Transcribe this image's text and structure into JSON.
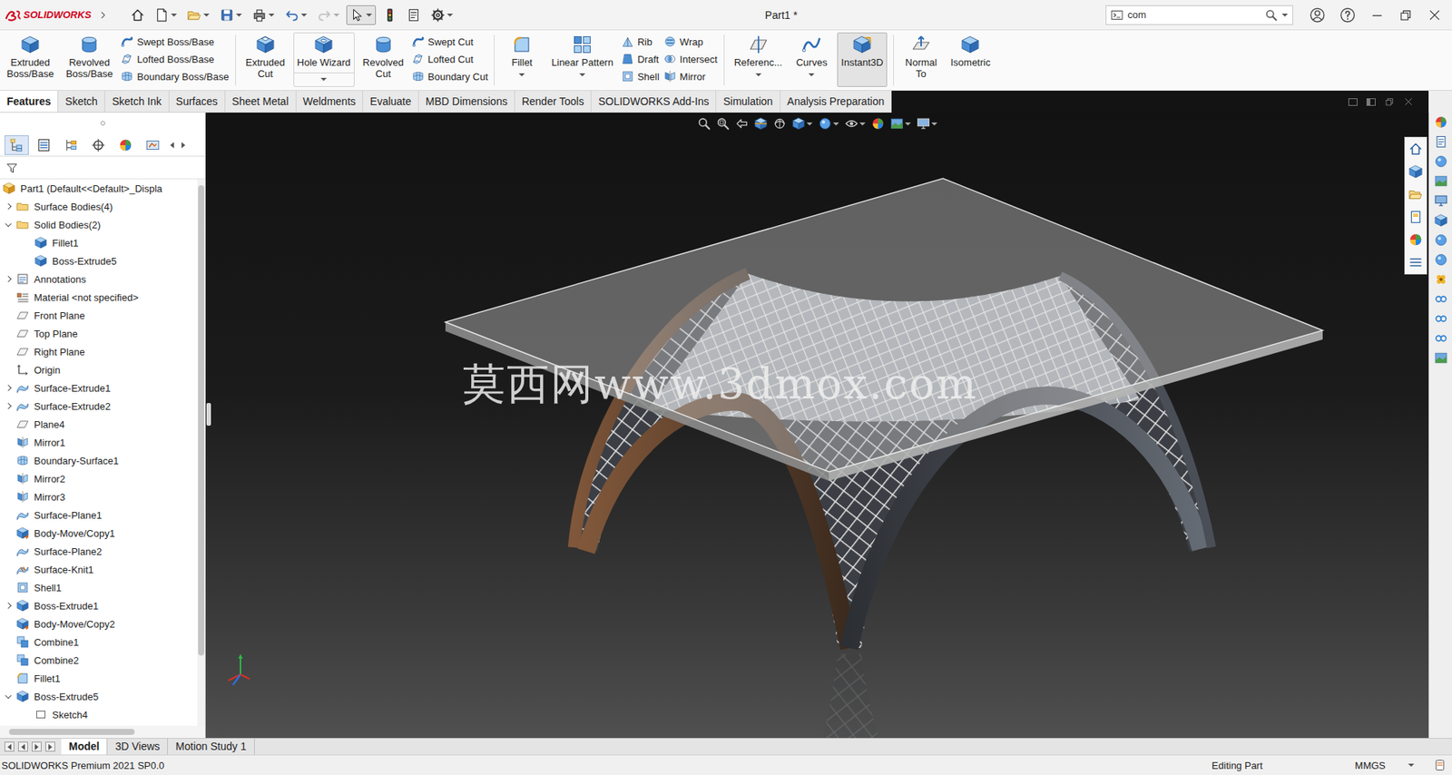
{
  "window": {
    "app": "SOLIDWORKS",
    "title": "Part1 *"
  },
  "quick_access": [
    {
      "dropdown": false,
      "selected": false,
      "disabled": false
    },
    {
      "dropdown": true,
      "selected": false,
      "disabled": false
    },
    {
      "dropdown": true,
      "selected": false,
      "disabled": false
    },
    {
      "dropdown": true,
      "selected": false,
      "disabled": false
    },
    {
      "dropdown": true,
      "selected": false,
      "disabled": false
    },
    {
      "dropdown": true,
      "selected": false,
      "disabled": false
    },
    {
      "dropdown": true,
      "selected": false,
      "disabled": true
    },
    {
      "dropdown": true,
      "selected": true,
      "disabled": false
    },
    {
      "dropdown": false,
      "selected": false,
      "disabled": false
    },
    {
      "dropdown": false,
      "selected": false,
      "disabled": false
    },
    {
      "dropdown": true,
      "selected": false,
      "disabled": false
    }
  ],
  "search": {
    "value": "com"
  },
  "ribbon": {
    "groups": [
      [
        {
          "kind": "large",
          "lines": [
            "Extruded",
            "Boss/Base"
          ],
          "selected": false,
          "dropdown": false
        },
        {
          "kind": "large",
          "lines": [
            "Revolved",
            "Boss/Base"
          ],
          "selected": false,
          "dropdown": false
        },
        {
          "kind": "stack",
          "items": [
            {
              "label": "Swept Boss/Base"
            },
            {
              "label": "Lofted Boss/Base"
            },
            {
              "label": "Boundary Boss/Base"
            }
          ]
        }
      ],
      [
        {
          "kind": "large",
          "lines": [
            "Extruded",
            "Cut"
          ],
          "selected": false,
          "dropdown": false
        },
        {
          "kind": "split",
          "lines": [
            "Hole Wizard"
          ],
          "selected": false,
          "dropdown": true
        },
        {
          "kind": "large",
          "lines": [
            "Revolved",
            "Cut"
          ],
          "selected": false,
          "dropdown": false
        },
        {
          "kind": "stack",
          "items": [
            {
              "label": "Swept Cut"
            },
            {
              "label": "Lofted Cut"
            },
            {
              "label": "Boundary Cut"
            }
          ]
        }
      ],
      [
        {
          "kind": "large",
          "lines": [
            "Fillet"
          ],
          "selected": false,
          "dropdown": true
        },
        {
          "kind": "large",
          "lines": [
            "Linear Pattern"
          ],
          "selected": false,
          "dropdown": true
        },
        {
          "kind": "stack",
          "items": [
            {
              "label": "Rib"
            },
            {
              "label": "Draft"
            },
            {
              "label": "Shell"
            }
          ]
        },
        {
          "kind": "stack",
          "items": [
            {
              "label": "Wrap"
            },
            {
              "label": "Intersect"
            },
            {
              "label": "Mirror"
            }
          ]
        }
      ],
      [
        {
          "kind": "large",
          "lines": [
            "Referenc..."
          ],
          "selected": false,
          "dropdown": true
        },
        {
          "kind": "large",
          "lines": [
            "Curves"
          ],
          "selected": false,
          "dropdown": true
        },
        {
          "kind": "large",
          "lines": [
            "Instant3D"
          ],
          "selected": true,
          "dropdown": false
        }
      ],
      [
        {
          "kind": "large",
          "lines": [
            "Normal",
            "To"
          ],
          "selected": false,
          "dropdown": false
        },
        {
          "kind": "large",
          "lines": [
            "Isometric"
          ],
          "selected": false,
          "dropdown": false
        }
      ]
    ]
  },
  "tabs": [
    {
      "label": "Features",
      "selected": true
    },
    {
      "label": "Sketch",
      "selected": false
    },
    {
      "label": "Sketch Ink",
      "selected": false
    },
    {
      "label": "Surfaces",
      "selected": false
    },
    {
      "label": "Sheet Metal",
      "selected": false
    },
    {
      "label": "Weldments",
      "selected": false
    },
    {
      "label": "Evaluate",
      "selected": false
    },
    {
      "label": "MBD Dimensions",
      "selected": false
    },
    {
      "label": "Render Tools",
      "selected": false
    },
    {
      "label": "SOLIDWORKS Add-Ins",
      "selected": false
    },
    {
      "label": "Simulation",
      "selected": false
    },
    {
      "label": "Analysis Preparation",
      "selected": false
    }
  ],
  "panel": {
    "tabs": [
      {
        "selected": true
      },
      {
        "selected": false
      },
      {
        "selected": false
      },
      {
        "selected": false
      },
      {
        "selected": false
      },
      {
        "selected": false
      }
    ]
  },
  "tree": [
    {
      "label": "Part1 (Default<<Default>_Displa",
      "depth": 0,
      "expandable": false,
      "expanded": false
    },
    {
      "label": "Surface Bodies(4)",
      "depth": 1,
      "expandable": true,
      "expanded": false
    },
    {
      "label": "Solid Bodies(2)",
      "depth": 1,
      "expandable": true,
      "expanded": true
    },
    {
      "label": "Fillet1",
      "depth": 2,
      "expandable": false,
      "expanded": false
    },
    {
      "label": "Boss-Extrude5",
      "depth": 2,
      "expandable": false,
      "expanded": false
    },
    {
      "label": "Annotations",
      "depth": 1,
      "expandable": true,
      "expanded": false
    },
    {
      "label": "Material <not specified>",
      "depth": 1,
      "expandable": false,
      "expanded": false
    },
    {
      "label": "Front Plane",
      "depth": 1,
      "expandable": false,
      "expanded": false
    },
    {
      "label": "Top Plane",
      "depth": 1,
      "expandable": false,
      "expanded": false
    },
    {
      "label": "Right Plane",
      "depth": 1,
      "expandable": false,
      "expanded": false
    },
    {
      "label": "Origin",
      "depth": 1,
      "expandable": false,
      "expanded": false
    },
    {
      "label": "Surface-Extrude1",
      "depth": 1,
      "expandable": true,
      "expanded": false
    },
    {
      "label": "Surface-Extrude2",
      "depth": 1,
      "expandable": true,
      "expanded": false
    },
    {
      "label": "Plane4",
      "depth": 1,
      "expandable": false,
      "expanded": false
    },
    {
      "label": "Mirror1",
      "depth": 1,
      "expandable": false,
      "expanded": false
    },
    {
      "label": "Boundary-Surface1",
      "depth": 1,
      "expandable": false,
      "expanded": false
    },
    {
      "label": "Mirror2",
      "depth": 1,
      "expandable": false,
      "expanded": false
    },
    {
      "label": "Mirror3",
      "depth": 1,
      "expandable": false,
      "expanded": false
    },
    {
      "label": "Surface-Plane1",
      "depth": 1,
      "expandable": false,
      "expanded": false
    },
    {
      "label": "Body-Move/Copy1",
      "depth": 1,
      "expandable": false,
      "expanded": false
    },
    {
      "label": "Surface-Plane2",
      "depth": 1,
      "expandable": false,
      "expanded": false
    },
    {
      "label": "Surface-Knit1",
      "depth": 1,
      "expandable": false,
      "expanded": false
    },
    {
      "label": "Shell1",
      "depth": 1,
      "expandable": false,
      "expanded": false
    },
    {
      "label": "Boss-Extrude1",
      "depth": 1,
      "expandable": true,
      "expanded": false
    },
    {
      "label": "Body-Move/Copy2",
      "depth": 1,
      "expandable": false,
      "expanded": false
    },
    {
      "label": "Combine1",
      "depth": 1,
      "expandable": false,
      "expanded": false
    },
    {
      "label": "Combine2",
      "depth": 1,
      "expandable": false,
      "expanded": false
    },
    {
      "label": "Fillet1",
      "depth": 1,
      "expandable": false,
      "expanded": false
    },
    {
      "label": "Boss-Extrude5",
      "depth": 1,
      "expandable": true,
      "expanded": true
    },
    {
      "label": "Sketch4",
      "depth": 2,
      "expandable": false,
      "expanded": false
    }
  ],
  "viewport": {
    "watermark": "莫西网www.3dmox.com"
  },
  "bottom_tabs": [
    {
      "label": "Model",
      "selected": true
    },
    {
      "label": "3D Views",
      "selected": false
    },
    {
      "label": "Motion Study 1",
      "selected": false
    }
  ],
  "status_bar": {
    "product": "SOLIDWORKS Premium 2021 SP0.0",
    "mode": "Editing Part",
    "units": "MMGS"
  }
}
